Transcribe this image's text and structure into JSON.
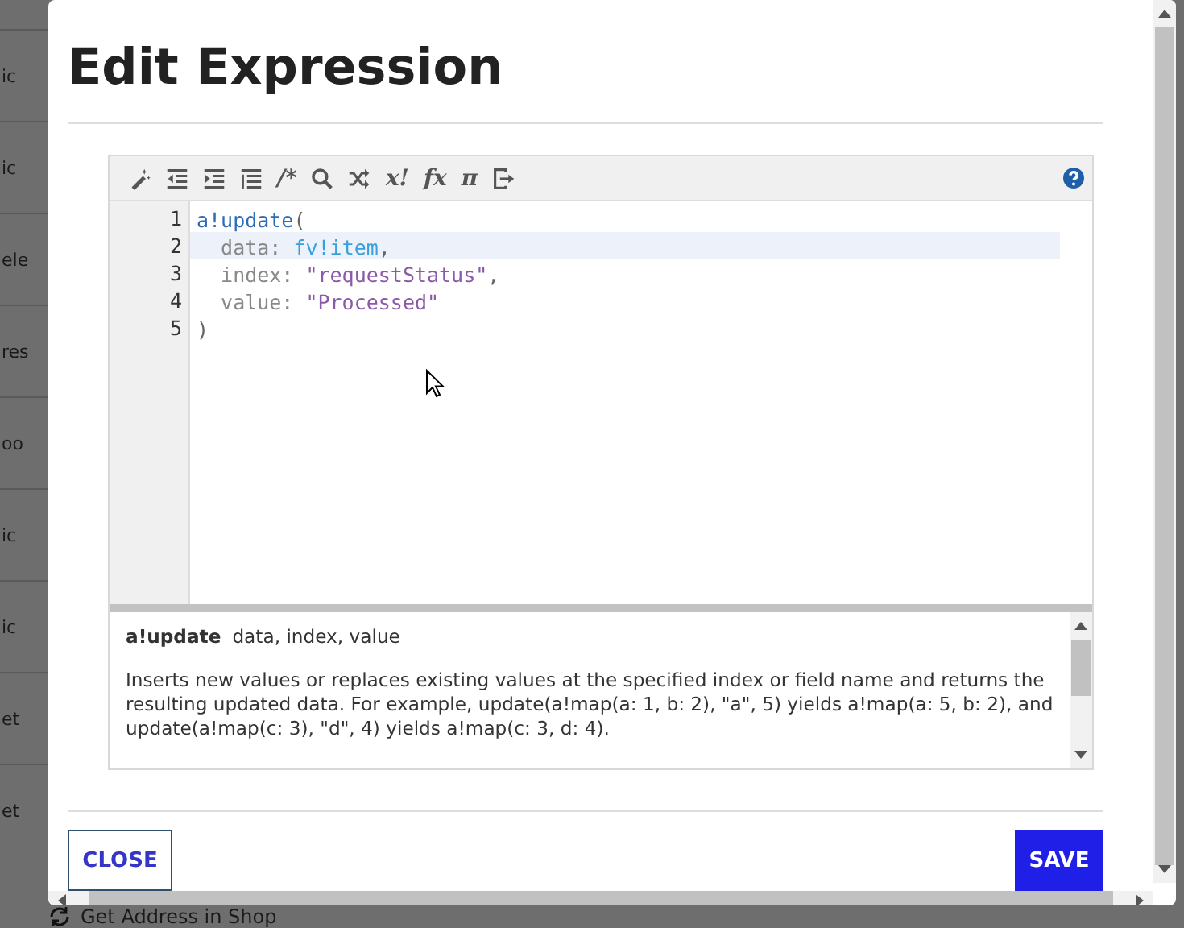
{
  "background": {
    "row_fragments": [
      "ic",
      "ic",
      "ele",
      "res",
      "oo",
      "ic",
      "ic",
      "et",
      "et"
    ],
    "bottom_item": "Get Address in Shop"
  },
  "dialog": {
    "title": "Edit Expression",
    "toolbar": [
      {
        "kind": "icon"
      },
      {
        "kind": "icon"
      },
      {
        "kind": "icon"
      },
      {
        "kind": "icon"
      },
      {
        "kind": "glyph",
        "label": "/*"
      },
      {
        "kind": "icon"
      },
      {
        "kind": "icon"
      },
      {
        "kind": "glyph",
        "label": "x!"
      },
      {
        "kind": "glyph",
        "label": "fx"
      },
      {
        "kind": "glyph",
        "label": "π"
      },
      {
        "kind": "icon"
      }
    ],
    "code_lines": [
      {
        "number": "1",
        "active": false,
        "tokens": [
          {
            "kind": "fn",
            "text": "a!update"
          },
          {
            "kind": "punct",
            "text": "("
          }
        ]
      },
      {
        "number": "2",
        "active": true,
        "tokens": [
          {
            "kind": "key",
            "text": "  data: "
          },
          {
            "kind": "var",
            "text": "fv!item"
          },
          {
            "kind": "punct",
            "text": ","
          }
        ]
      },
      {
        "number": "3",
        "active": false,
        "tokens": [
          {
            "kind": "key",
            "text": "  index: "
          },
          {
            "kind": "str",
            "text": "\"requestStatus\""
          },
          {
            "kind": "punct",
            "text": ","
          }
        ]
      },
      {
        "number": "4",
        "active": false,
        "tokens": [
          {
            "kind": "key",
            "text": "  value: "
          },
          {
            "kind": "str",
            "text": "\"Processed\""
          }
        ]
      },
      {
        "number": "5",
        "active": false,
        "tokens": [
          {
            "kind": "punct",
            "text": ")"
          }
        ]
      }
    ],
    "doc": {
      "function_name": "a!update",
      "parameters": "data, index, value",
      "description": "Inserts new values or replaces existing values at the specified index or field name and returns the resulting updated data. For example, update(a!map(a: 1, b: 2), \"a\", 5) yields a!map(a: 5, b: 2), and update(a!map(c: 3), \"d\", 4) yields a!map(c: 3, d: 4)."
    },
    "buttons": [
      {
        "kind": "secondary",
        "label": "CLOSE"
      },
      {
        "kind": "primary",
        "label": "SAVE"
      }
    ]
  }
}
